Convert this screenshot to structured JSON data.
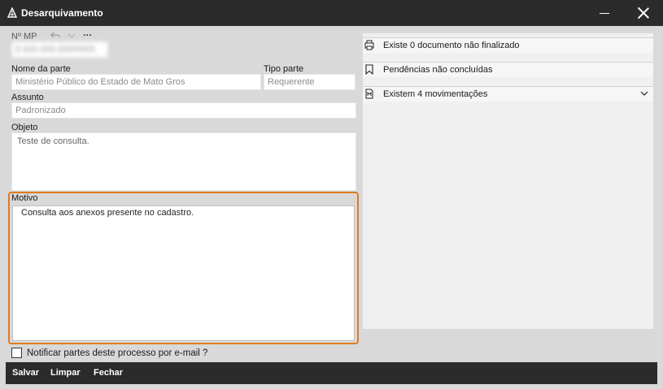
{
  "window": {
    "title": "Desarquivamento"
  },
  "form": {
    "mp_label": "Nº MP",
    "mp_value": "0.000.000.000/0000",
    "menu_more": "···",
    "nome_parte_label": "Nome da parte",
    "nome_parte_value": "Ministério Público do Estado de Mato Gros",
    "tipo_parte_label": "Tipo parte",
    "tipo_parte_value": "Requerente",
    "assunto_label": "Assunto",
    "assunto_value": "Padronizado",
    "objeto_label": "Objeto",
    "objeto_value": "Teste de consulta.",
    "motivo_label": "Motivo",
    "motivo_value": "Consulta aos anexos presente no cadastro.",
    "notify_label": "Notificar partes deste processo por e-mail ?"
  },
  "toolbar": {
    "save_label": "Salvar",
    "clear_label": "Limpar",
    "close_label": "Fechar"
  },
  "right_panel": {
    "items": [
      {
        "label": "Existe 0 documento não finalizado",
        "icon": "printer-doc-icon"
      },
      {
        "label": "Pendências não concluídas",
        "icon": "bookmark-icon"
      },
      {
        "label": "Existem 4 movimentações",
        "icon": "movement-doc-icon"
      }
    ]
  },
  "colors": {
    "title_bg": "#2b2b2b",
    "window_bg": "#d9d9d9",
    "focus_border": "#e07b1f"
  }
}
